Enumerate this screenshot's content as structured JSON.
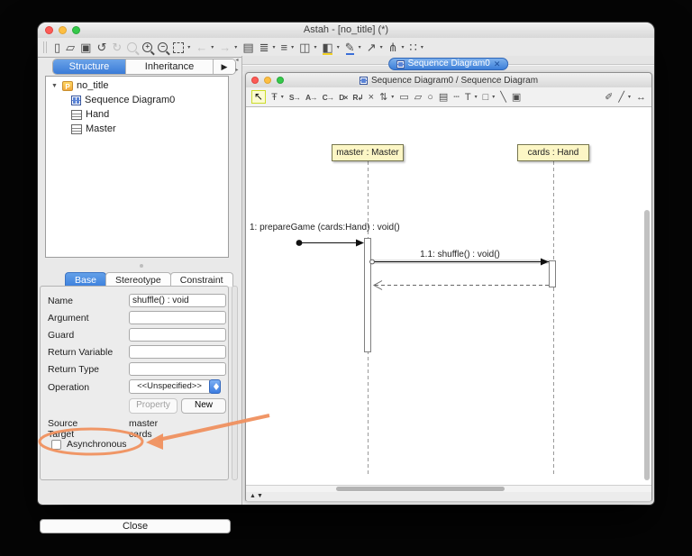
{
  "titlebar": {
    "title": "Astah - [no_title] (*)"
  },
  "ui": {
    "caret": "▾",
    "disclosure": "▼",
    "more_arrow": "▶",
    "collapse_left": "◂",
    "collapse_right": "▸",
    "scroll_up": "▲",
    "scroll_down": "▼"
  },
  "main_toolbar": {
    "icons": [
      {
        "name": "new-file",
        "glyph": "▯"
      },
      {
        "name": "open",
        "glyph": "▱"
      },
      {
        "name": "save",
        "glyph": "▣"
      },
      {
        "name": "undo",
        "glyph": "↺"
      },
      {
        "name": "redo",
        "glyph": "↻"
      },
      {
        "name": "zoom",
        "glyph": ""
      },
      {
        "name": "zoom-in",
        "glyph": "+"
      },
      {
        "name": "zoom-out",
        "glyph": "−"
      },
      {
        "name": "fit-view",
        "glyph": ""
      },
      {
        "name": "back",
        "glyph": "←"
      },
      {
        "name": "forward",
        "glyph": "→"
      },
      {
        "name": "map-view",
        "glyph": "▤"
      },
      {
        "name": "align-vertical",
        "glyph": "≣"
      },
      {
        "name": "align-horizontal",
        "glyph": "≡"
      },
      {
        "name": "layers",
        "glyph": "◫"
      },
      {
        "name": "fill-color",
        "glyph": "◧"
      },
      {
        "name": "pen-color",
        "glyph": "✎"
      },
      {
        "name": "connector",
        "glyph": "↗"
      },
      {
        "name": "tree-layout",
        "glyph": "⋔"
      },
      {
        "name": "grid-layout",
        "glyph": "∷"
      }
    ]
  },
  "sidebar": {
    "structure_tab": "Structure",
    "inheritance_tab": "Inheritance",
    "tree": {
      "root": "no_title",
      "package_glyph": "P",
      "items": [
        "Sequence Diagram0",
        "Hand",
        "Master"
      ]
    },
    "props": {
      "tabs": [
        "Base",
        "Stereotype",
        "Constraint"
      ],
      "fields": [
        {
          "label": "Name",
          "value": "shuffle() : void"
        },
        {
          "label": "Argument",
          "value": ""
        },
        {
          "label": "Guard",
          "value": ""
        },
        {
          "label": "Return Variable",
          "value": ""
        },
        {
          "label": "Return Type",
          "value": ""
        }
      ],
      "operation_label": "Operation",
      "operation_value": "<<Unspecified>>",
      "property_button": "Property",
      "new_button": "New",
      "source_label": "Source",
      "source_value": "master",
      "target_label": "Target",
      "target_value": "cards",
      "async_label": "Asynchronous"
    },
    "close_button": "Close"
  },
  "diagram": {
    "tab": {
      "label": "Sequence Diagram0",
      "close": "✕"
    },
    "titlebar": "Sequence Diagram0 / Sequence Diagram",
    "toolbar": {
      "icons": [
        {
          "name": "select-tool",
          "glyph": "↖"
        },
        {
          "name": "lifeline-tool",
          "glyph": "Ŧ"
        },
        {
          "name": "sync-message-tool",
          "glyph": "S→"
        },
        {
          "name": "async-message-tool",
          "glyph": "A→"
        },
        {
          "name": "create-message-tool",
          "glyph": "C→"
        },
        {
          "name": "destroy-message-tool",
          "glyph": "D×"
        },
        {
          "name": "reply-message-tool",
          "glyph": "R↲"
        },
        {
          "name": "stop-tool",
          "glyph": "×"
        },
        {
          "name": "duration-tool",
          "glyph": "⇅"
        },
        {
          "name": "combined-fragment-tool",
          "glyph": "▭"
        },
        {
          "name": "interaction-use-tool",
          "glyph": "▱"
        },
        {
          "name": "oval-tool",
          "glyph": "○"
        },
        {
          "name": "note-tool",
          "glyph": "▤"
        },
        {
          "name": "anchor-tool",
          "glyph": "┄"
        },
        {
          "name": "text-tool",
          "glyph": "T"
        },
        {
          "name": "rect-tool",
          "glyph": "□"
        },
        {
          "name": "line-tool",
          "glyph": "╲"
        },
        {
          "name": "image-tool",
          "glyph": "▣"
        },
        {
          "name": "stamp-tool",
          "glyph": "✐"
        },
        {
          "name": "polyline-tool",
          "glyph": "╱"
        },
        {
          "name": "resize-tool",
          "glyph": "↔"
        }
      ]
    },
    "lifelines": [
      {
        "name": "master : Master"
      },
      {
        "name": "cards : Hand"
      }
    ],
    "messages": [
      {
        "label": "1: prepareGame (cards:Hand) : void()"
      },
      {
        "label": "1.1: shuffle() : void()"
      }
    ]
  },
  "colors": {
    "accent_blue": "#3d7fd9",
    "annotation_orange": "#f0915f",
    "lifeline_fill": "#fcf6c5",
    "select_highlight": "#ccdc29"
  }
}
